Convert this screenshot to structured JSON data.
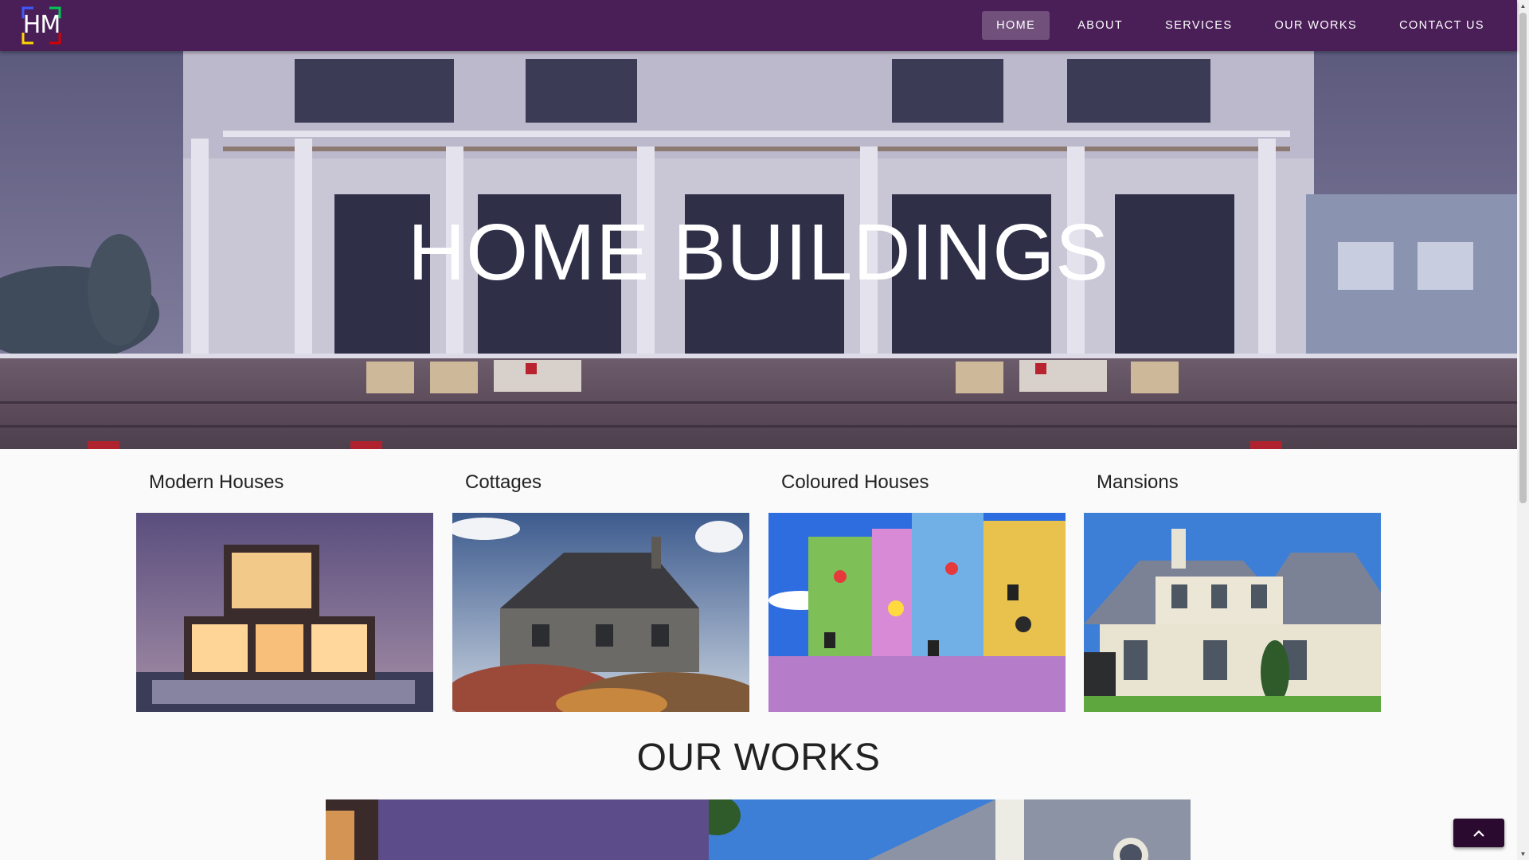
{
  "brand": {
    "logo_text": "HM"
  },
  "nav": {
    "items": [
      {
        "label": "HOME",
        "active": true
      },
      {
        "label": "ABOUT",
        "active": false
      },
      {
        "label": "SERVICES",
        "active": false
      },
      {
        "label": "OUR WORKS",
        "active": false
      },
      {
        "label": "CONTACT US",
        "active": false
      }
    ]
  },
  "hero": {
    "title": "HOME BUILDINGS"
  },
  "categories": [
    {
      "title": "Modern Houses"
    },
    {
      "title": "Cottages"
    },
    {
      "title": "Coloured Houses"
    },
    {
      "title": "Mansions"
    }
  ],
  "works": {
    "title": "OUR WORKS"
  },
  "icons": {
    "logo": "hm-logo-icon",
    "scroll_top": "chevron-up-icon"
  },
  "colors": {
    "navbar": "#4a1f58",
    "scroll_top_button": "#2a0a2e",
    "page_background": "#fafafa"
  }
}
